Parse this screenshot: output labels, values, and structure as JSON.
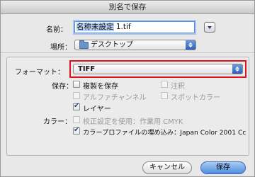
{
  "window": {
    "title": "別名で保存"
  },
  "filename": {
    "label": "名前：",
    "value_selected": "名称未設定",
    "value_rest": " 1.tif"
  },
  "location": {
    "label": "場所：",
    "value": "デスクトップ"
  },
  "format": {
    "label": "フォーマット：",
    "value": "TIFF"
  },
  "save_section": {
    "label": "保存：",
    "options": {
      "copy": {
        "label": "複製を保存",
        "checked": false,
        "enabled": true
      },
      "notes": {
        "label": "注釈",
        "checked": false,
        "enabled": false
      },
      "alpha": {
        "label": "アルファチャンネル",
        "checked": false,
        "enabled": false
      },
      "spot": {
        "label": "スポットカラー",
        "checked": false,
        "enabled": false
      },
      "layers": {
        "label": "レイヤー",
        "checked": true,
        "enabled": true
      }
    }
  },
  "color_section": {
    "label": "カラー：",
    "options": {
      "proof": {
        "label": "校正設定を使用：作業用 CMYK",
        "checked": false,
        "enabled": false
      },
      "icc": {
        "label": "カラープロファイルの埋め込み：Japan Color 2001 Cc",
        "checked": true,
        "enabled": true
      }
    }
  },
  "buttons": {
    "cancel": "キャンセル",
    "save": "保存"
  },
  "colors": {
    "highlight": "#e0141d",
    "accent": "#4f8ee0"
  }
}
